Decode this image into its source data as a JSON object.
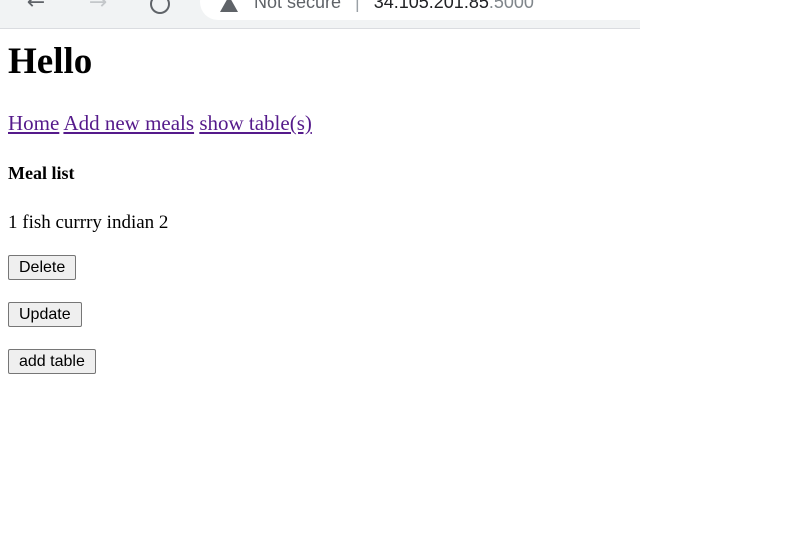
{
  "browser": {
    "security_label": "Not secure",
    "separator": "|",
    "url_host": "34.105.201.85",
    "url_port": ":5000",
    "back_icon": "arrow-left-icon",
    "forward_icon": "arrow-right-icon",
    "reload_icon": "reload-icon",
    "warning_icon": "warning-triangle-icon"
  },
  "page": {
    "title": "Hello",
    "nav_links": [
      {
        "label": "Home"
      },
      {
        "label": "Add new meals"
      },
      {
        "label": "show table(s)"
      }
    ],
    "section_heading": "Meal list",
    "meals": [
      {
        "text": "1 fish currry indian 2"
      }
    ],
    "buttons": {
      "delete": "Delete",
      "update": "Update",
      "add_table": "add table"
    }
  },
  "colors": {
    "link_visited": "#551a8b",
    "button_bg": "#efefef",
    "button_border": "#767676",
    "chrome_bg": "#f1f3f4"
  }
}
